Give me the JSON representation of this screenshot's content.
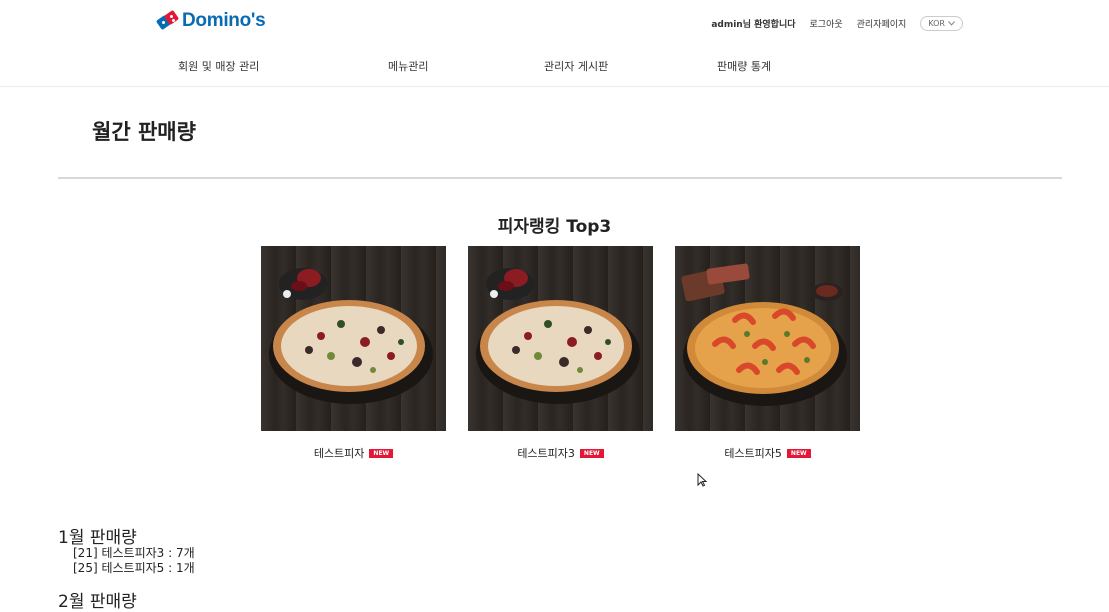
{
  "header": {
    "logo_text": "Domino's",
    "welcome": "admin님 환영합니다",
    "logout": "로그아웃",
    "admin_page": "관리자페이지",
    "language": "KOR"
  },
  "nav": {
    "items": [
      "회원 및 매장 관리",
      "메뉴관리",
      "관리자 게시판",
      "판매량 통계"
    ]
  },
  "page": {
    "title": "월간 판매량",
    "ranking_title": "피자랭킹 Top3"
  },
  "ranking": [
    {
      "name": "테스트피자",
      "badge": "NEW",
      "image": "combination-pizza"
    },
    {
      "name": "테스트피자3",
      "badge": "NEW",
      "image": "combination-pizza"
    },
    {
      "name": "테스트피자5",
      "badge": "NEW",
      "image": "shrimp-pizza"
    }
  ],
  "monthly": [
    {
      "title": "1월 판매량",
      "items": [
        "[21] 테스트피자3 : 7개",
        "[25] 테스트피자5 : 1개"
      ]
    },
    {
      "title": "2월 판매량",
      "items": []
    }
  ],
  "colors": {
    "brand_blue": "#0a6bb5",
    "brand_red": "#e31837"
  }
}
